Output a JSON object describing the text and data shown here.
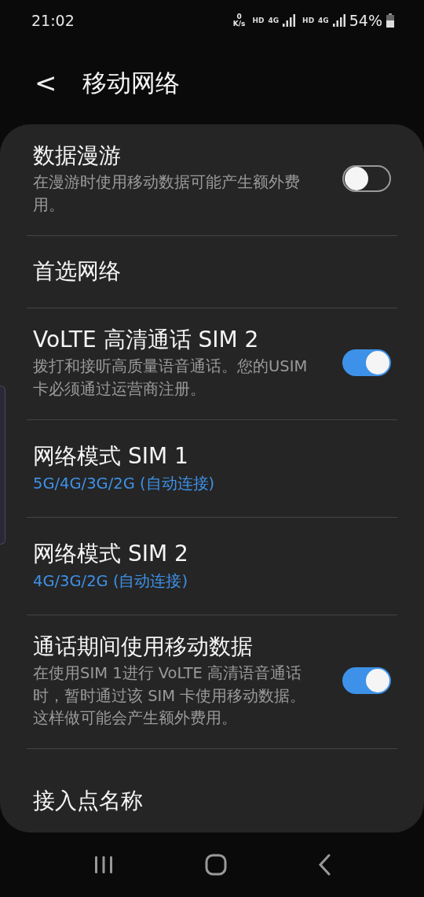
{
  "status_bar": {
    "time": "21:02",
    "speed_value": "0",
    "speed_unit": "K/s",
    "sim1_hd": "HD",
    "sim1_network": "4G",
    "sim2_hd": "HD",
    "sim2_network": "4G",
    "battery": "54%"
  },
  "header": {
    "back": "<",
    "title": "移动网络"
  },
  "items": [
    {
      "kind": "toggle",
      "title": "数据漫游",
      "description": "在漫游时使用移动数据可能产生额外费用。",
      "on": false
    },
    {
      "kind": "plain",
      "title": "首选网络"
    },
    {
      "kind": "toggle",
      "title": "VoLTE 高清通话 SIM 2",
      "description": "拨打和接听高质量语音通话。您的USIM 卡必须通过运营商注册。",
      "on": true
    },
    {
      "kind": "value",
      "title": "网络模式 SIM 1",
      "value": "5G/4G/3G/2G (自动连接)"
    },
    {
      "kind": "value",
      "title": "网络模式 SIM 2",
      "value": "4G/3G/2G (自动连接)"
    },
    {
      "kind": "toggle",
      "title": "通话期间使用移动数据",
      "description": "在使用SIM 1进行 VoLTE 高清语音通话时，暂时通过该 SIM 卡使用移动数据。这样做可能会产生额外费用。",
      "on": true
    },
    {
      "kind": "plain",
      "title": "接入点名称"
    }
  ]
}
